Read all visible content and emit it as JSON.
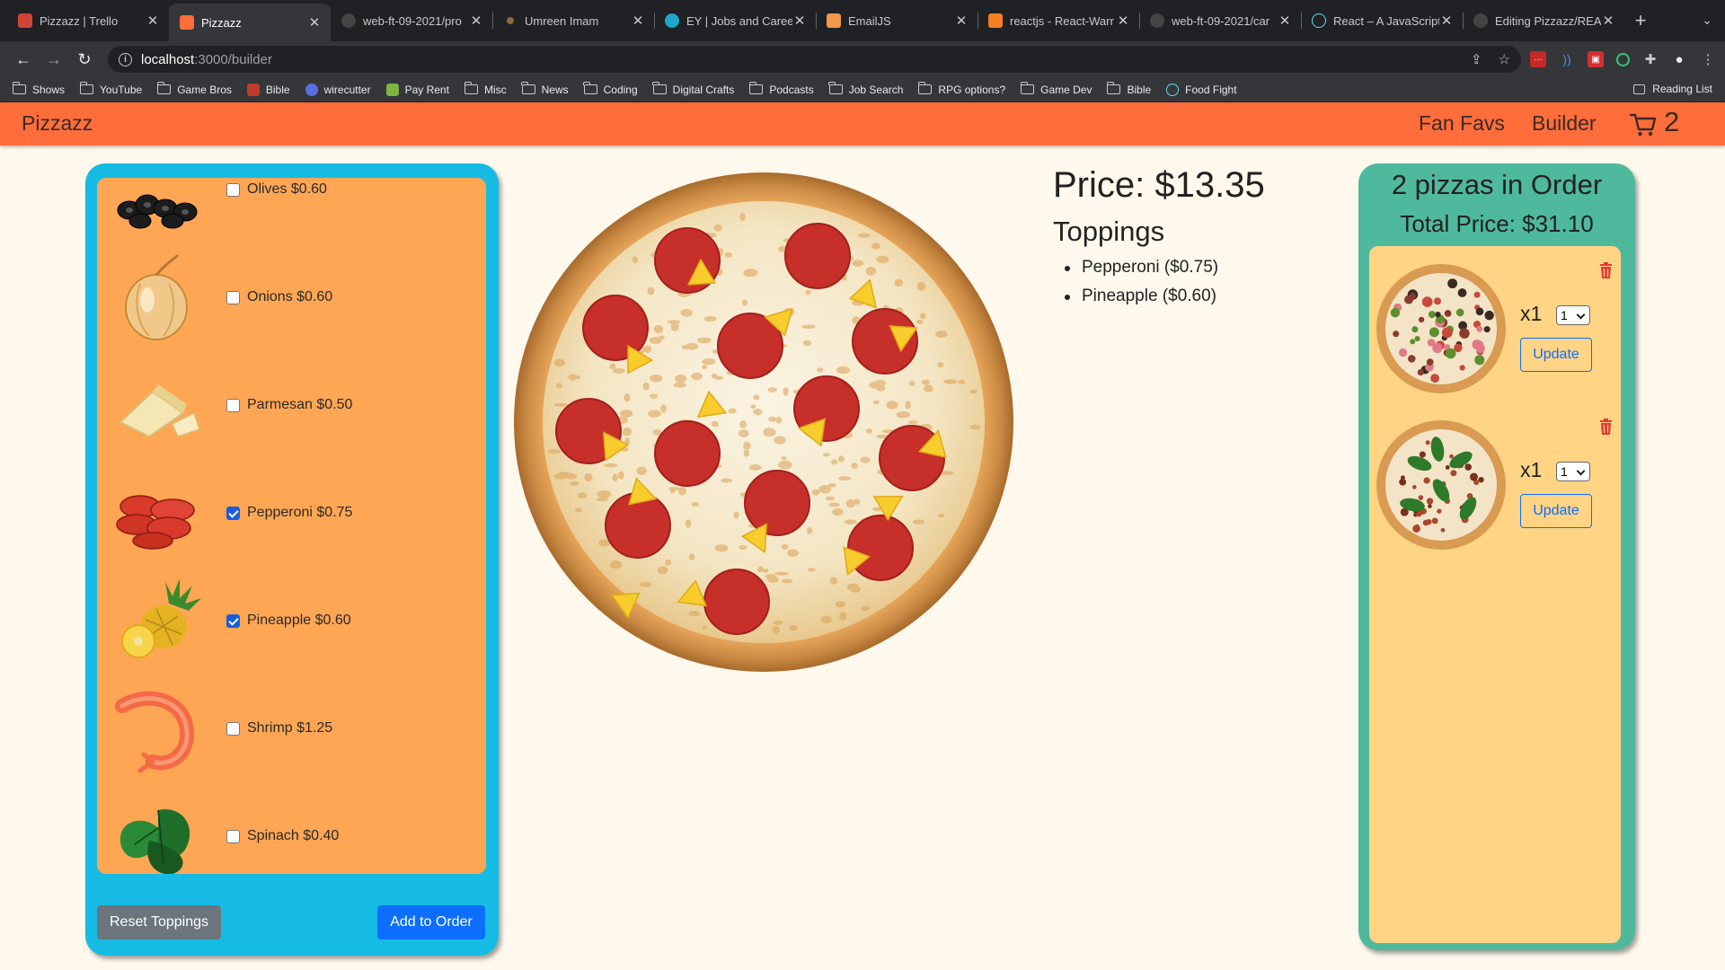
{
  "browser": {
    "tabs": [
      {
        "title": "Pizzazz | Trello",
        "icon": "trello-icon",
        "color": "#d04437",
        "active": false
      },
      {
        "title": "Pizzazz",
        "icon": "pizza-favicon",
        "color": "#ff6d3a",
        "active": true
      },
      {
        "title": "web-ft-09-2021/pro",
        "icon": "github-icon",
        "color": "#444444",
        "active": false
      },
      {
        "title": "Umreen Imam",
        "icon": "site-icon",
        "color": "#8a6d3b",
        "active": false
      },
      {
        "title": "EY | Jobs and Caree",
        "icon": "ey-icon",
        "color": "#1ea7c9",
        "active": false
      },
      {
        "title": "EmailJS",
        "icon": "emailjs-icon",
        "color": "#f2994a",
        "active": false
      },
      {
        "title": "reactjs - React-Warr",
        "icon": "stackoverflow-icon",
        "color": "#f48024",
        "active": false
      },
      {
        "title": "web-ft-09-2021/car",
        "icon": "github-icon",
        "color": "#444444",
        "active": false
      },
      {
        "title": "React – A JavaScript",
        "icon": "react-icon",
        "color": "#61dafb",
        "active": false
      },
      {
        "title": "Editing Pizzazz/REA",
        "icon": "github-icon",
        "color": "#444444",
        "active": false
      }
    ],
    "url_host": "localhost",
    "url_rest": ":3000/builder",
    "bookmarks": [
      {
        "label": "Shows",
        "type": "folder"
      },
      {
        "label": "YouTube",
        "type": "folder"
      },
      {
        "label": "Game Bros",
        "type": "folder"
      },
      {
        "label": "Bible",
        "type": "site",
        "color": "#c0392b"
      },
      {
        "label": "wirecutter",
        "type": "site",
        "color": "#5b6ee1"
      },
      {
        "label": "Pay Rent",
        "type": "site",
        "color": "#7cb342"
      },
      {
        "label": "Misc",
        "type": "folder"
      },
      {
        "label": "News",
        "type": "folder"
      },
      {
        "label": "Coding",
        "type": "folder"
      },
      {
        "label": "Digital Crafts",
        "type": "folder"
      },
      {
        "label": "Podcasts",
        "type": "folder"
      },
      {
        "label": "Job Search",
        "type": "folder"
      },
      {
        "label": "RPG options?",
        "type": "folder"
      },
      {
        "label": "Game Dev",
        "type": "folder"
      },
      {
        "label": "Bible",
        "type": "folder"
      },
      {
        "label": "Food Fight",
        "type": "site",
        "color": "#61dafb"
      }
    ],
    "reading_list": "Reading List"
  },
  "app": {
    "brand": "Pizzazz",
    "nav": {
      "fan_favs": "Fan Favs",
      "builder": "Builder"
    },
    "cart_count": "2"
  },
  "toppings": [
    {
      "name": "Olives",
      "price": "$0.60",
      "label": "Olives $0.60",
      "checked": false,
      "icon": "olives-image"
    },
    {
      "name": "Onions",
      "price": "$0.60",
      "label": "Onions $0.60",
      "checked": false,
      "icon": "onion-image"
    },
    {
      "name": "Parmesan",
      "price": "$0.50",
      "label": "Parmesan $0.50",
      "checked": false,
      "icon": "parmesan-image"
    },
    {
      "name": "Pepperoni",
      "price": "$0.75",
      "label": "Pepperoni $0.75",
      "checked": true,
      "icon": "pepperoni-image"
    },
    {
      "name": "Pineapple",
      "price": "$0.60",
      "label": "Pineapple $0.60",
      "checked": true,
      "icon": "pineapple-image"
    },
    {
      "name": "Shrimp",
      "price": "$1.25",
      "label": "Shrimp $1.25",
      "checked": false,
      "icon": "shrimp-image"
    },
    {
      "name": "Spinach",
      "price": "$0.40",
      "label": "Spinach $0.40",
      "checked": false,
      "icon": "spinach-image"
    }
  ],
  "buttons": {
    "reset": "Reset Toppings",
    "add": "Add to Order"
  },
  "builder": {
    "price": "Price: $13.35",
    "toppings_heading": "Toppings",
    "selected": [
      "Pepperoni ($0.75)",
      "Pineapple ($0.60)"
    ]
  },
  "order": {
    "count_text": "2 pizzas in Order",
    "total_text": "Total Price: $31.10",
    "items": [
      {
        "qty_label": "x1",
        "qty_value": "1",
        "update": "Update"
      },
      {
        "qty_label": "x1",
        "qty_value": "1",
        "update": "Update"
      }
    ]
  },
  "colors": {
    "navbar": "#ff6d3a",
    "toppings_panel": "#16bbe4",
    "toppings_list": "#ffa654",
    "order_panel": "#4fb99d",
    "order_list": "#ffd484",
    "primary": "#0d6efd",
    "secondary": "#6c757d"
  }
}
